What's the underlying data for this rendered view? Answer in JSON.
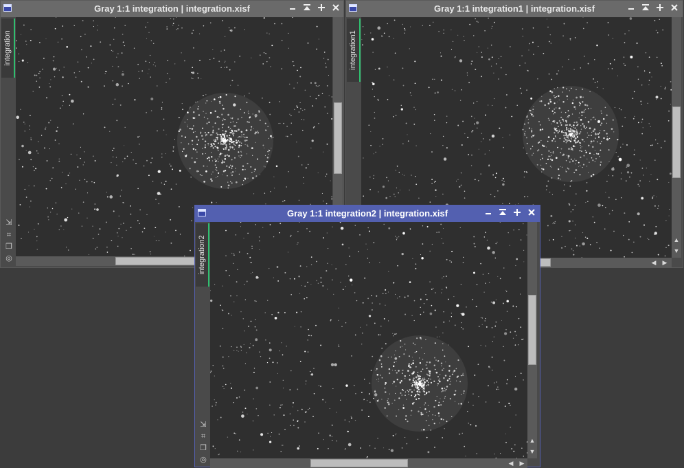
{
  "windows": {
    "w1": {
      "title": "Gray 1:1 integration | integration.xisf",
      "tab_label": "integration"
    },
    "w2": {
      "title": "Gray 1:1 integration1 | integration.xisf",
      "tab_label": "integration1"
    },
    "w3": {
      "title": "Gray 1:1 integration2 | integration.xisf",
      "tab_label": "integration2"
    }
  },
  "colors": {
    "desktop": "#3c3c3c",
    "inactive_titlebar": "#6a6a6a",
    "active_titlebar": "#5360b0",
    "tab_accent": "#2fbf6f"
  },
  "icons": [
    "window-icon",
    "minimize-icon",
    "shade-icon",
    "maximize-icon",
    "close-icon",
    "zoom-to-fit-icon",
    "fit-view-icon",
    "new-preview-icon",
    "target-icon"
  ]
}
